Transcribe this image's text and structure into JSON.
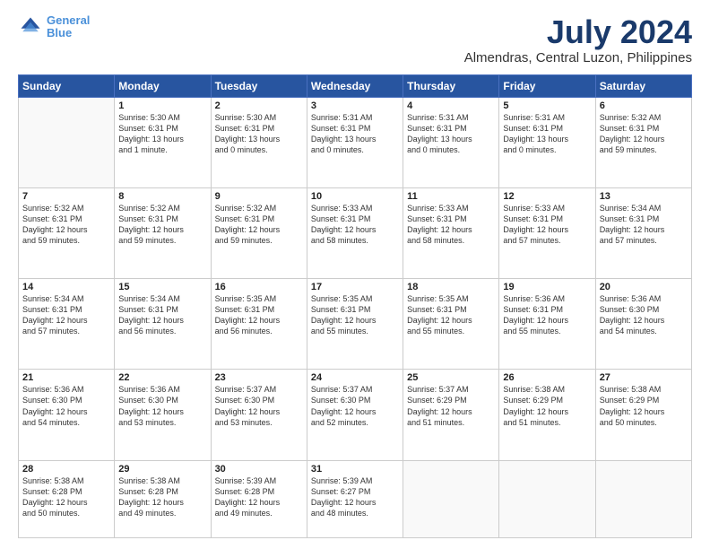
{
  "header": {
    "logo_line1": "General",
    "logo_line2": "Blue",
    "title": "July 2024",
    "subtitle": "Almendras, Central Luzon, Philippines"
  },
  "calendar": {
    "days_of_week": [
      "Sunday",
      "Monday",
      "Tuesday",
      "Wednesday",
      "Thursday",
      "Friday",
      "Saturday"
    ],
    "weeks": [
      [
        {
          "day": "",
          "info": ""
        },
        {
          "day": "1",
          "info": "Sunrise: 5:30 AM\nSunset: 6:31 PM\nDaylight: 13 hours\nand 1 minute."
        },
        {
          "day": "2",
          "info": "Sunrise: 5:30 AM\nSunset: 6:31 PM\nDaylight: 13 hours\nand 0 minutes."
        },
        {
          "day": "3",
          "info": "Sunrise: 5:31 AM\nSunset: 6:31 PM\nDaylight: 13 hours\nand 0 minutes."
        },
        {
          "day": "4",
          "info": "Sunrise: 5:31 AM\nSunset: 6:31 PM\nDaylight: 13 hours\nand 0 minutes."
        },
        {
          "day": "5",
          "info": "Sunrise: 5:31 AM\nSunset: 6:31 PM\nDaylight: 13 hours\nand 0 minutes."
        },
        {
          "day": "6",
          "info": "Sunrise: 5:32 AM\nSunset: 6:31 PM\nDaylight: 12 hours\nand 59 minutes."
        }
      ],
      [
        {
          "day": "7",
          "info": "Sunrise: 5:32 AM\nSunset: 6:31 PM\nDaylight: 12 hours\nand 59 minutes."
        },
        {
          "day": "8",
          "info": "Sunrise: 5:32 AM\nSunset: 6:31 PM\nDaylight: 12 hours\nand 59 minutes."
        },
        {
          "day": "9",
          "info": "Sunrise: 5:32 AM\nSunset: 6:31 PM\nDaylight: 12 hours\nand 59 minutes."
        },
        {
          "day": "10",
          "info": "Sunrise: 5:33 AM\nSunset: 6:31 PM\nDaylight: 12 hours\nand 58 minutes."
        },
        {
          "day": "11",
          "info": "Sunrise: 5:33 AM\nSunset: 6:31 PM\nDaylight: 12 hours\nand 58 minutes."
        },
        {
          "day": "12",
          "info": "Sunrise: 5:33 AM\nSunset: 6:31 PM\nDaylight: 12 hours\nand 57 minutes."
        },
        {
          "day": "13",
          "info": "Sunrise: 5:34 AM\nSunset: 6:31 PM\nDaylight: 12 hours\nand 57 minutes."
        }
      ],
      [
        {
          "day": "14",
          "info": "Sunrise: 5:34 AM\nSunset: 6:31 PM\nDaylight: 12 hours\nand 57 minutes."
        },
        {
          "day": "15",
          "info": "Sunrise: 5:34 AM\nSunset: 6:31 PM\nDaylight: 12 hours\nand 56 minutes."
        },
        {
          "day": "16",
          "info": "Sunrise: 5:35 AM\nSunset: 6:31 PM\nDaylight: 12 hours\nand 56 minutes."
        },
        {
          "day": "17",
          "info": "Sunrise: 5:35 AM\nSunset: 6:31 PM\nDaylight: 12 hours\nand 55 minutes."
        },
        {
          "day": "18",
          "info": "Sunrise: 5:35 AM\nSunset: 6:31 PM\nDaylight: 12 hours\nand 55 minutes."
        },
        {
          "day": "19",
          "info": "Sunrise: 5:36 AM\nSunset: 6:31 PM\nDaylight: 12 hours\nand 55 minutes."
        },
        {
          "day": "20",
          "info": "Sunrise: 5:36 AM\nSunset: 6:30 PM\nDaylight: 12 hours\nand 54 minutes."
        }
      ],
      [
        {
          "day": "21",
          "info": "Sunrise: 5:36 AM\nSunset: 6:30 PM\nDaylight: 12 hours\nand 54 minutes."
        },
        {
          "day": "22",
          "info": "Sunrise: 5:36 AM\nSunset: 6:30 PM\nDaylight: 12 hours\nand 53 minutes."
        },
        {
          "day": "23",
          "info": "Sunrise: 5:37 AM\nSunset: 6:30 PM\nDaylight: 12 hours\nand 53 minutes."
        },
        {
          "day": "24",
          "info": "Sunrise: 5:37 AM\nSunset: 6:30 PM\nDaylight: 12 hours\nand 52 minutes."
        },
        {
          "day": "25",
          "info": "Sunrise: 5:37 AM\nSunset: 6:29 PM\nDaylight: 12 hours\nand 51 minutes."
        },
        {
          "day": "26",
          "info": "Sunrise: 5:38 AM\nSunset: 6:29 PM\nDaylight: 12 hours\nand 51 minutes."
        },
        {
          "day": "27",
          "info": "Sunrise: 5:38 AM\nSunset: 6:29 PM\nDaylight: 12 hours\nand 50 minutes."
        }
      ],
      [
        {
          "day": "28",
          "info": "Sunrise: 5:38 AM\nSunset: 6:28 PM\nDaylight: 12 hours\nand 50 minutes."
        },
        {
          "day": "29",
          "info": "Sunrise: 5:38 AM\nSunset: 6:28 PM\nDaylight: 12 hours\nand 49 minutes."
        },
        {
          "day": "30",
          "info": "Sunrise: 5:39 AM\nSunset: 6:28 PM\nDaylight: 12 hours\nand 49 minutes."
        },
        {
          "day": "31",
          "info": "Sunrise: 5:39 AM\nSunset: 6:27 PM\nDaylight: 12 hours\nand 48 minutes."
        },
        {
          "day": "",
          "info": ""
        },
        {
          "day": "",
          "info": ""
        },
        {
          "day": "",
          "info": ""
        }
      ]
    ]
  }
}
